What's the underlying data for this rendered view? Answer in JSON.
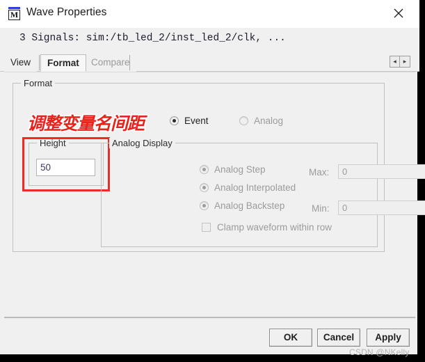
{
  "window": {
    "title": "Wave Properties",
    "icon": "modelsim-m-icon",
    "close_label": "✕"
  },
  "signals": {
    "text": "3 Signals: sim:/tb_led_2/inst_led_2/clk, ..."
  },
  "tabs": [
    {
      "label": "View",
      "selected": false,
      "disabled": false
    },
    {
      "label": "Format",
      "selected": true,
      "disabled": false
    },
    {
      "label": "Compare",
      "selected": false,
      "disabled": true
    }
  ],
  "tab_scroll": {
    "left_label": "◂",
    "right_label": "▸"
  },
  "format_group": {
    "title": "Format",
    "mode_radios": [
      {
        "label": "Event",
        "checked": true,
        "disabled": false
      },
      {
        "label": "Analog",
        "checked": false,
        "disabled": true
      }
    ]
  },
  "height_group": {
    "title": "Height",
    "value": "50",
    "placeholder": ""
  },
  "analog_display": {
    "title": "Analog Display",
    "radios": [
      {
        "label": "Analog Step",
        "checked": true,
        "disabled": true
      },
      {
        "label": "Analog Interpolated",
        "checked": true,
        "disabled": true
      },
      {
        "label": "Analog Backstep",
        "checked": true,
        "disabled": true
      }
    ],
    "max_label": "Max:",
    "max_value": "0",
    "min_label": "Min:",
    "min_value": "0",
    "clamp_label": "Clamp waveform within row",
    "clamp_checked": false
  },
  "annotation": {
    "text": "调整变量名间距",
    "color": "#e8231c",
    "box_color": "#ee2b24"
  },
  "footer": {
    "ok": "OK",
    "cancel": "Cancel",
    "apply": "Apply"
  },
  "watermark": {
    "text": "CSDN @NKelly"
  }
}
